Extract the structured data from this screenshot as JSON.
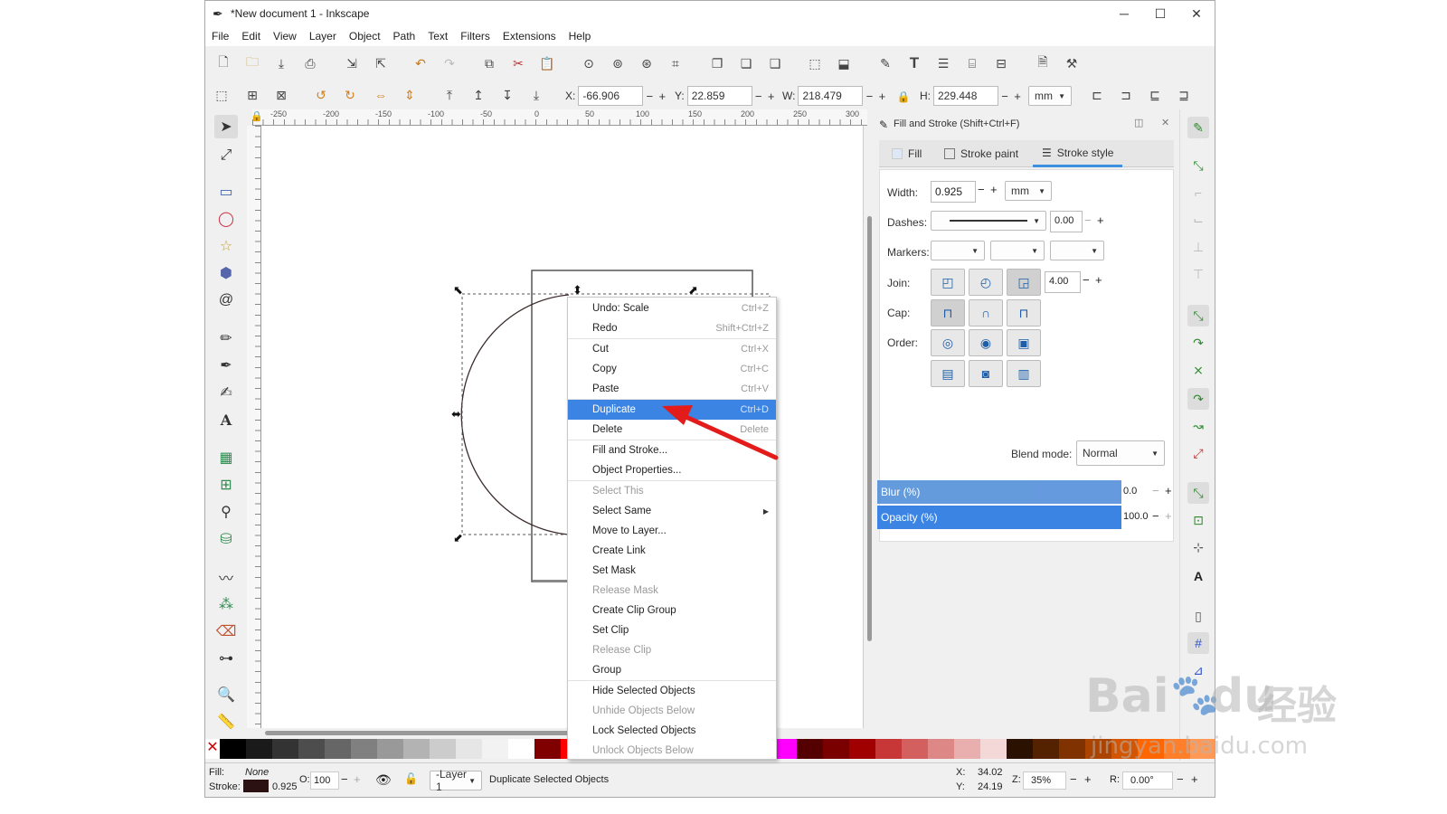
{
  "window": {
    "title": "*New document 1 - Inkscape",
    "minimize": "─",
    "maximize": "☐",
    "close": "✕"
  },
  "menubar": [
    "File",
    "Edit",
    "View",
    "Layer",
    "Object",
    "Path",
    "Text",
    "Filters",
    "Extensions",
    "Help"
  ],
  "toolbar": {
    "x_label": "X:",
    "x_value": "-66.906",
    "y_label": "Y:",
    "y_value": "22.859",
    "w_label": "W:",
    "w_value": "218.479",
    "h_label": "H:",
    "h_value": "229.448",
    "unit": "mm",
    "minus": "−",
    "plus": "+"
  },
  "ruler": {
    "labels": [
      "-250",
      "-200",
      "-150",
      "-100",
      "-50",
      "0",
      "50",
      "100",
      "150",
      "200",
      "250",
      "300"
    ]
  },
  "panel": {
    "title": "Fill and Stroke (Shift+Ctrl+F)",
    "tabs": {
      "fill": "Fill",
      "stroke_paint": "Stroke paint",
      "stroke_style": "Stroke style"
    },
    "width_label": "Width:",
    "width_value": "0.925",
    "width_unit": "mm",
    "dashes_label": "Dashes:",
    "dashes_value": "0.00",
    "markers_label": "Markers:",
    "join_label": "Join:",
    "join_value": "4.00",
    "cap_label": "Cap:",
    "order_label": "Order:",
    "blend_label": "Blend mode:",
    "blend_value": "Normal",
    "blur_label": "Blur (%)",
    "blur_value": "0.0",
    "opacity_label": "Opacity (%)",
    "opacity_value": "100.0"
  },
  "context_menu": {
    "items": [
      {
        "label": "Undo: Scale",
        "shortcut": "Ctrl+Z"
      },
      {
        "label": "Redo",
        "shortcut": "Shift+Ctrl+Z"
      },
      {
        "label": "Cut",
        "shortcut": "Ctrl+X"
      },
      {
        "label": "Copy",
        "shortcut": "Ctrl+C"
      },
      {
        "label": "Paste",
        "shortcut": "Ctrl+V"
      },
      {
        "label": "Duplicate",
        "shortcut": "Ctrl+D"
      },
      {
        "label": "Delete",
        "shortcut": "Delete"
      },
      {
        "label": "Fill and Stroke...",
        "shortcut": ""
      },
      {
        "label": "Object Properties...",
        "shortcut": ""
      },
      {
        "label": "Select This",
        "shortcut": ""
      },
      {
        "label": "Select Same",
        "shortcut": ""
      },
      {
        "label": "Move to Layer...",
        "shortcut": ""
      },
      {
        "label": "Create Link",
        "shortcut": ""
      },
      {
        "label": "Set Mask",
        "shortcut": ""
      },
      {
        "label": "Release Mask",
        "shortcut": ""
      },
      {
        "label": "Create Clip Group",
        "shortcut": ""
      },
      {
        "label": "Set Clip",
        "shortcut": ""
      },
      {
        "label": "Release Clip",
        "shortcut": ""
      },
      {
        "label": "Group",
        "shortcut": ""
      },
      {
        "label": "Hide Selected Objects",
        "shortcut": ""
      },
      {
        "label": "Unhide Objects Below",
        "shortcut": ""
      },
      {
        "label": "Lock Selected Objects",
        "shortcut": ""
      },
      {
        "label": "Unlock Objects Below",
        "shortcut": ""
      }
    ],
    "submenu_arrow": "▶"
  },
  "statusbar": {
    "fill_label": "Fill:",
    "fill_value": "None",
    "stroke_label": "Stroke:",
    "stroke_value": "0.925",
    "opacity_label": "O:",
    "opacity_value": "100",
    "layer": "-Layer 1",
    "message": "Duplicate Selected Objects",
    "x_label": "X:",
    "x_value": "34.02",
    "y_label": "Y:",
    "y_value": "24.19",
    "zoom_label": "Z:",
    "zoom_value": "35%",
    "rotate_label": "R:",
    "rotate_value": "0.00°"
  },
  "palette_colors": [
    "#000000",
    "#1a1a1a",
    "#333333",
    "#4d4d4d",
    "#666666",
    "#808080",
    "#999999",
    "#b3b3b3",
    "#cccccc",
    "#e6e6e6",
    "#f2f2f2",
    "#ffffff",
    "#800000",
    "#ff0000",
    "#808000",
    "#ffff00",
    "#008000",
    "#00ff00",
    "#00ffff",
    "#0000ff",
    "#800080",
    "#ff00ff",
    "#550000",
    "#7a0000",
    "#a00000",
    "#c83737",
    "#d35f5f",
    "#de8787",
    "#e9afaf",
    "#f4d7d7",
    "#2b1100",
    "#552200",
    "#803300",
    "#aa4400",
    "#d45500",
    "#ff6600",
    "#ff7f2a",
    "#ff9955"
  ],
  "colors": {
    "accent": "#3b84e3",
    "annotation_arrow": "#e31b1b"
  },
  "watermark": {
    "text": "Bai",
    "text2": "du",
    "cn": "经验",
    "url": "jingyan.baidu.com"
  }
}
